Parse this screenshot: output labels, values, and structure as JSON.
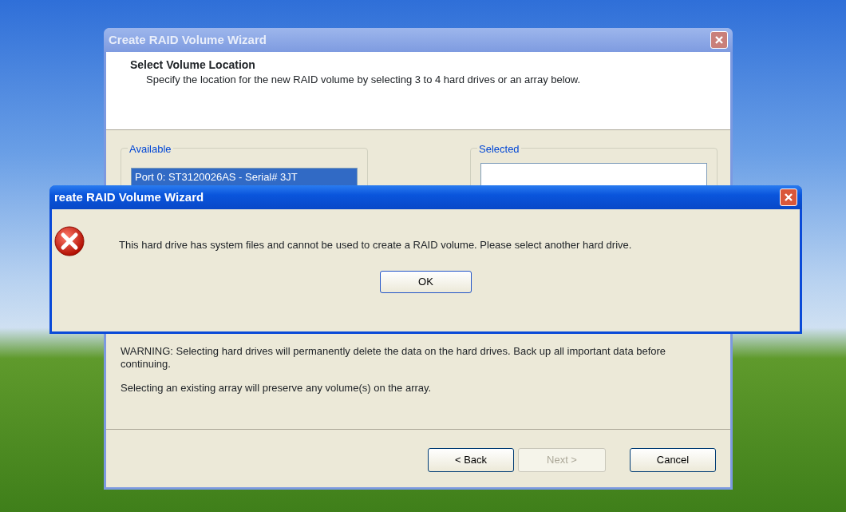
{
  "wizard": {
    "title": "Create RAID Volume Wizard",
    "header": {
      "title": "Select Volume Location",
      "subtitle": "Specify the location for the new RAID volume by selecting 3 to 4 hard drives or an array below."
    },
    "available": {
      "label": "Available",
      "items": [
        {
          "text": "Port 0: ST3120026AS - Serial# 3JT",
          "selected": true
        }
      ]
    },
    "selected_group": {
      "label": "Selected"
    },
    "notes": [
      "WARNING: Selecting hard drives will permanently delete the data on the hard drives. Back up all important data before continuing.",
      "Selecting an existing array will preserve any volume(s) on the array."
    ],
    "buttons": [
      {
        "label": "< Back",
        "disabled": false
      },
      {
        "label": "Next >",
        "disabled": true
      },
      {
        "label": "Cancel",
        "disabled": false
      }
    ]
  },
  "alert": {
    "title": "reate RAID Volume Wizard",
    "kind": "error",
    "message": "This hard drive has system files and cannot be used to create a RAID volume. Please select another hard drive.",
    "buttons": [
      {
        "label": "OK"
      }
    ]
  }
}
